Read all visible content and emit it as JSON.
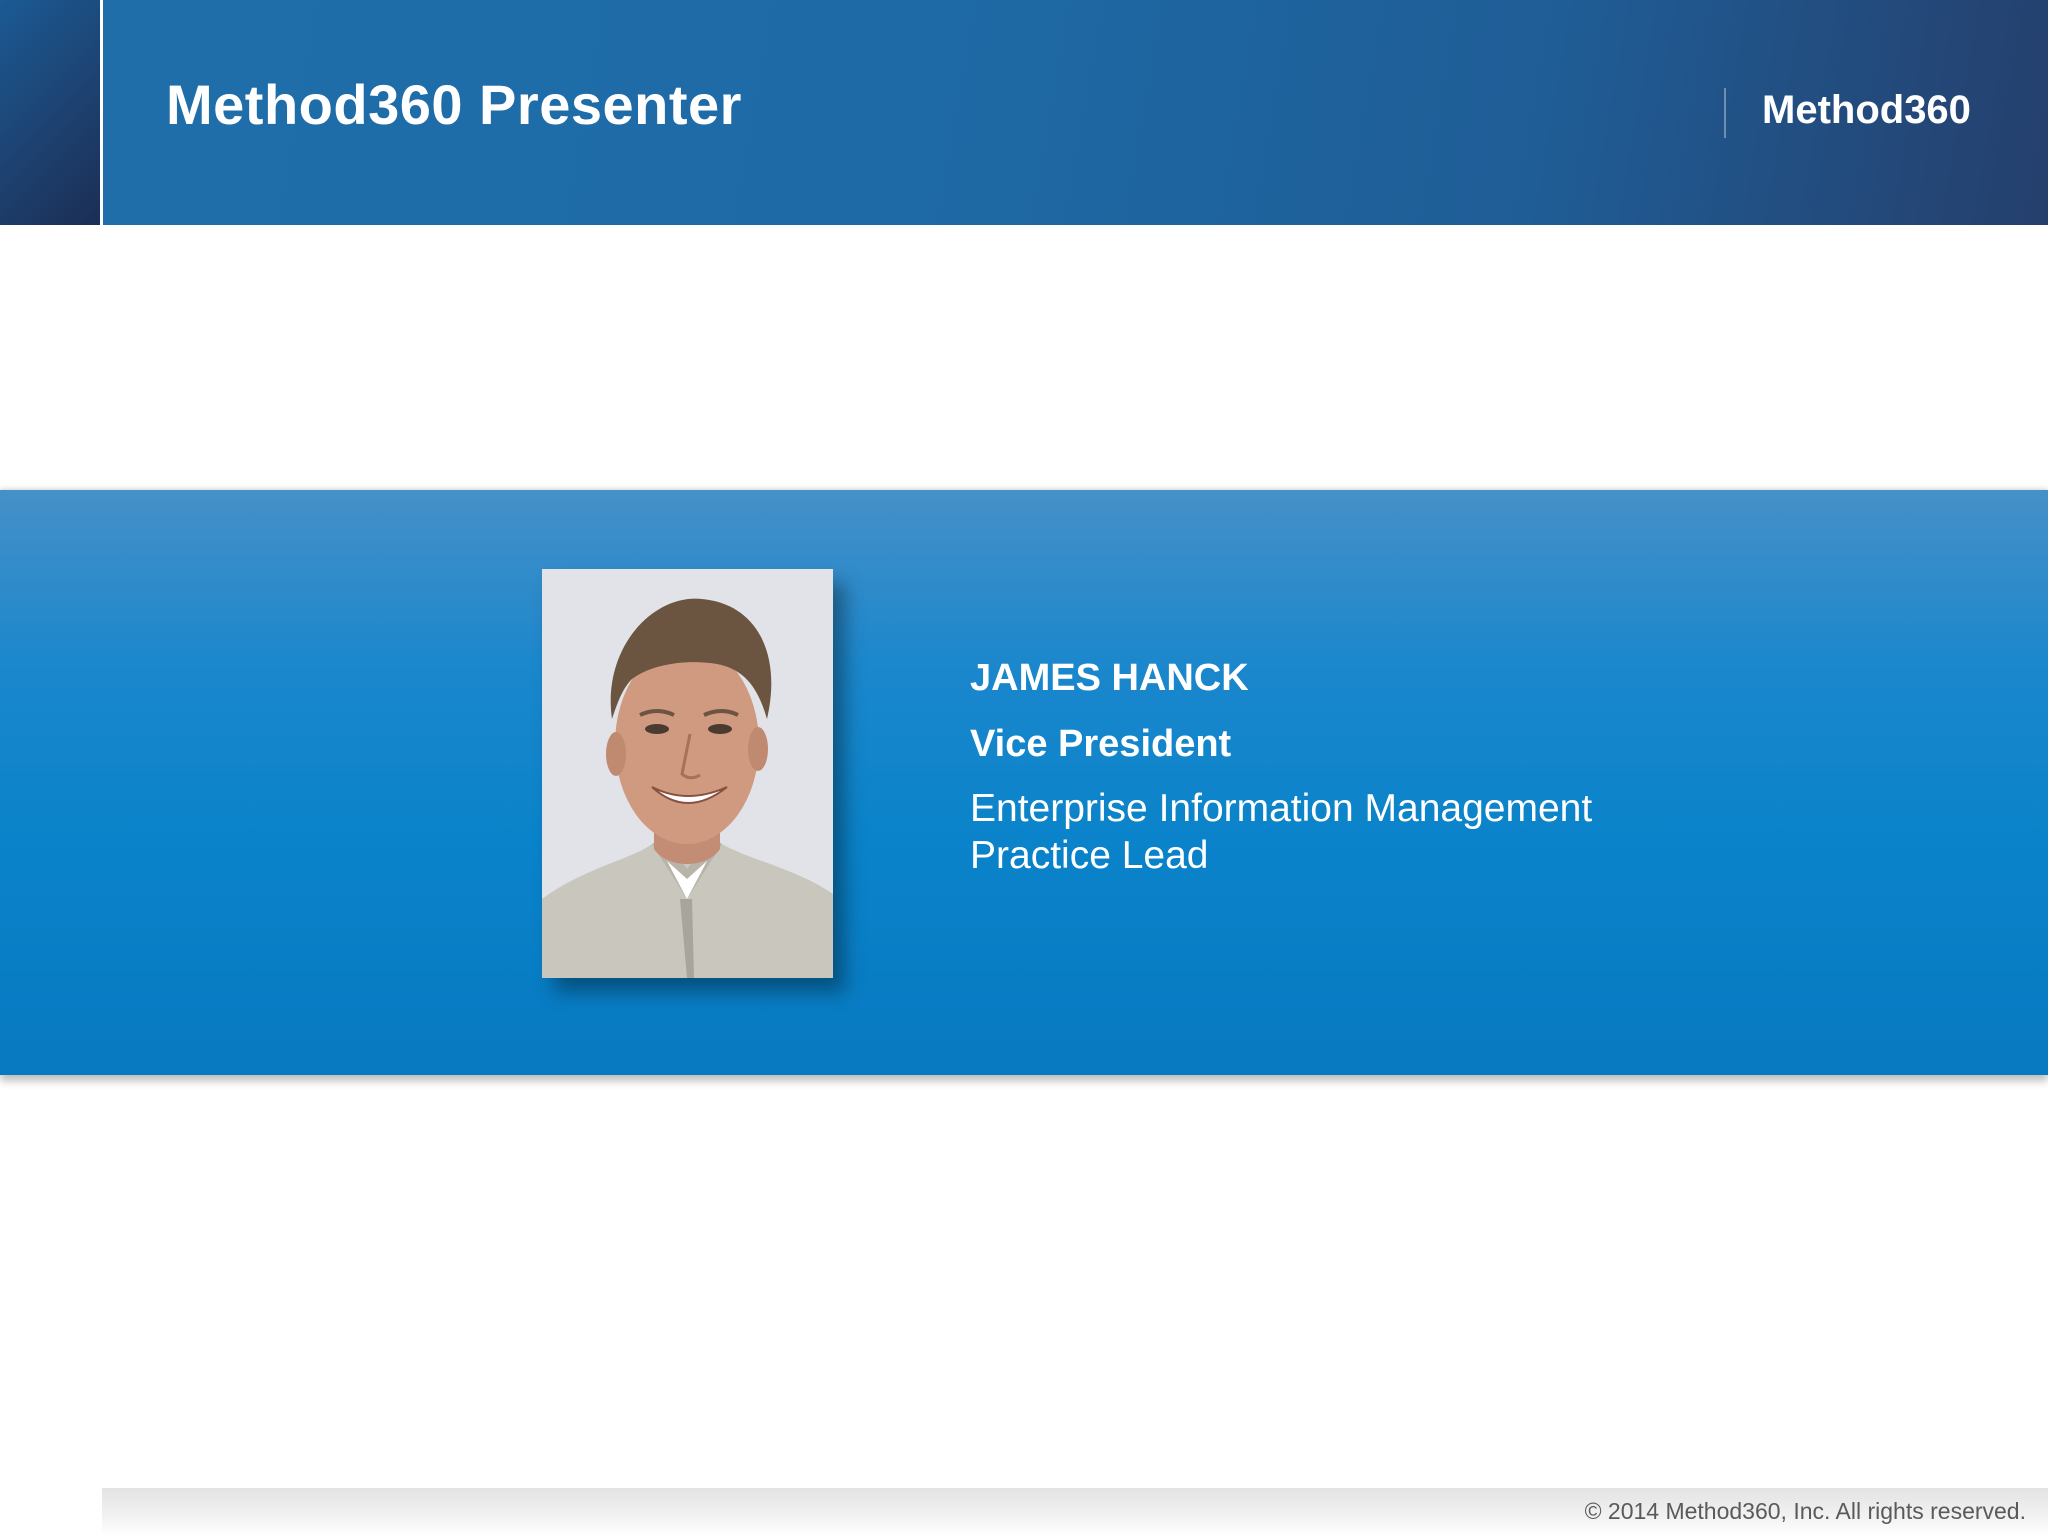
{
  "header": {
    "title": "Method360 Presenter",
    "logo": "Method360"
  },
  "presenter": {
    "name": "JAMES HANCK",
    "role": "Vice President",
    "department": "Enterprise Information Management Practice Lead"
  },
  "footer": {
    "copyright": "© 2014 Method360, Inc. All rights reserved."
  },
  "colors": {
    "header_blue": "#1f6eaa",
    "band_blue": "#0a83ca",
    "text_white": "#ffffff"
  }
}
